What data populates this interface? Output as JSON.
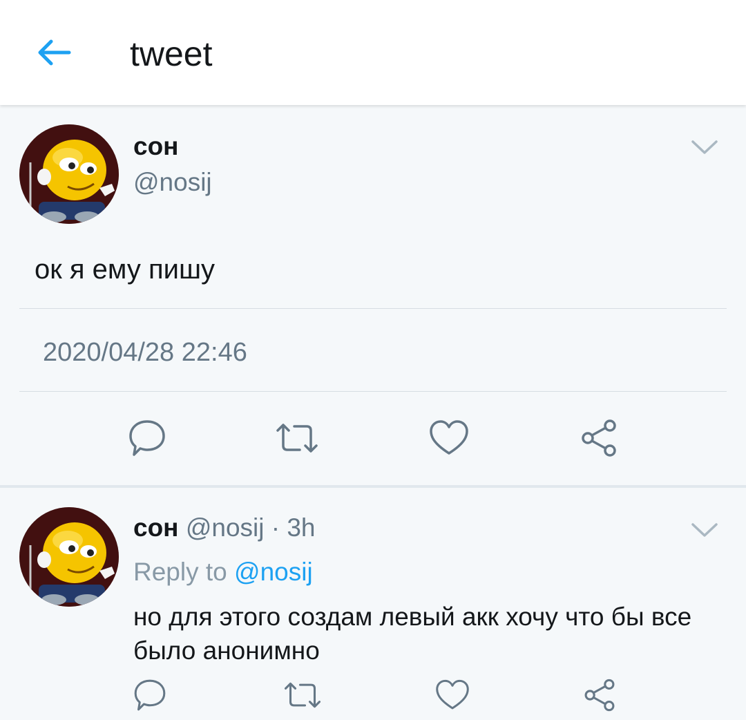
{
  "header": {
    "back_icon": "arrow-left-icon",
    "title": "tweet"
  },
  "tweet": {
    "author_name": "сон",
    "author_handle": "@nosij",
    "text": "ок я ему пишу",
    "timestamp": "2020/04/28 22:46",
    "actions": [
      "reply-icon",
      "retweet-icon",
      "like-icon",
      "share-icon"
    ]
  },
  "reply": {
    "author_name": "сон",
    "author_handle": "@nosij",
    "time_ago": "3h",
    "separator": "·",
    "reply_to_label": "Reply to",
    "reply_to_handle": "@nosij",
    "text": "но для этого создам левый акк хочу что бы все было анонимно",
    "actions": [
      "reply-icon",
      "retweet-icon",
      "like-icon",
      "share-icon"
    ]
  },
  "colors": {
    "accent": "#1da1f2",
    "text_primary": "#14171a",
    "text_secondary": "#657786",
    "background": "#f5f8fa",
    "icon": "#657786"
  }
}
